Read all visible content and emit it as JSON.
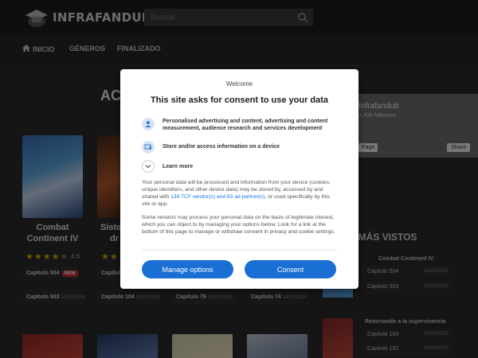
{
  "site": {
    "logo_text": "INFRAFANDUB",
    "search_placeholder": "Buscar...",
    "nav": [
      {
        "label": "INICIO"
      },
      {
        "label": "GÉNEROS"
      },
      {
        "label": "FINALIZADO"
      }
    ],
    "section_heading_partial": "AC",
    "cards": [
      {
        "title_line1": "Combat",
        "title_line2": "Continent IV",
        "rating": "4.6",
        "chapters": [
          {
            "label": "Capitulo 504",
            "badge": "NEW",
            "date": ""
          },
          {
            "label": "Capitulo 503",
            "date": "14/10/2024"
          }
        ]
      },
      {
        "title_line1": "Siste",
        "title_line2": "dr",
        "chapters": [
          {
            "label": "Capitulo",
            "date": ""
          },
          {
            "label": "Capitulo 104",
            "date": "14/10/2024"
          }
        ]
      },
      {
        "chapters": [
          {
            "label": "Capitulo 79",
            "date": "14/10/2024"
          }
        ]
      },
      {
        "chapters": [
          {
            "label": "Capitulo 74",
            "date": "14/10/2024"
          }
        ]
      }
    ],
    "facebook": {
      "name": "Infrafandub",
      "followers": "4,496 followers",
      "page_label": "Page",
      "share_label": "Share"
    },
    "most_viewed_title": "O MÁS VISTOS",
    "most_viewed": [
      {
        "title": "Combat Continent IV",
        "rows": [
          {
            "label": "Capitulo 504",
            "date": "14/10/2024"
          },
          {
            "label": "Capitulo 503",
            "date": "14/10/2024"
          }
        ]
      },
      {
        "title": "Retornando a la supervivencia",
        "rows": [
          {
            "label": "Capitulo 163",
            "date": "20/05/2023"
          },
          {
            "label": "Capitulo 162",
            "date": "14/05/2023"
          }
        ]
      }
    ]
  },
  "consent": {
    "welcome": "Welcome",
    "title": "This site asks for consent to use your data",
    "purposes": [
      {
        "icon": "person-icon",
        "text": "Personalised advertising and content, advertising and content measurement, audience research and services development"
      },
      {
        "icon": "device-icon",
        "text": "Store and/or access information on a device"
      }
    ],
    "learn_more": "Learn more",
    "para1_before": "Your personal data will be processed and information from your device (cookies, unique identifiers, and other device data) may be stored by, accessed by and shared with ",
    "para1_link": "134 TCF vendor(s) and 63 ad partner(s)",
    "para1_after": ", or used specifically by this site or app.",
    "para2": "Some vendors may process your personal data on the basis of legitimate interest, which you can object to by managing your options below. Look for a link at the bottom of this page to manage or withdraw consent in privacy and cookie settings.",
    "manage_label": "Manage options",
    "consent_label": "Consent"
  },
  "colors": {
    "primary_button": "#1a6fd4",
    "link": "#1a73e8",
    "star": "#d4b106",
    "badge": "#d13030"
  }
}
